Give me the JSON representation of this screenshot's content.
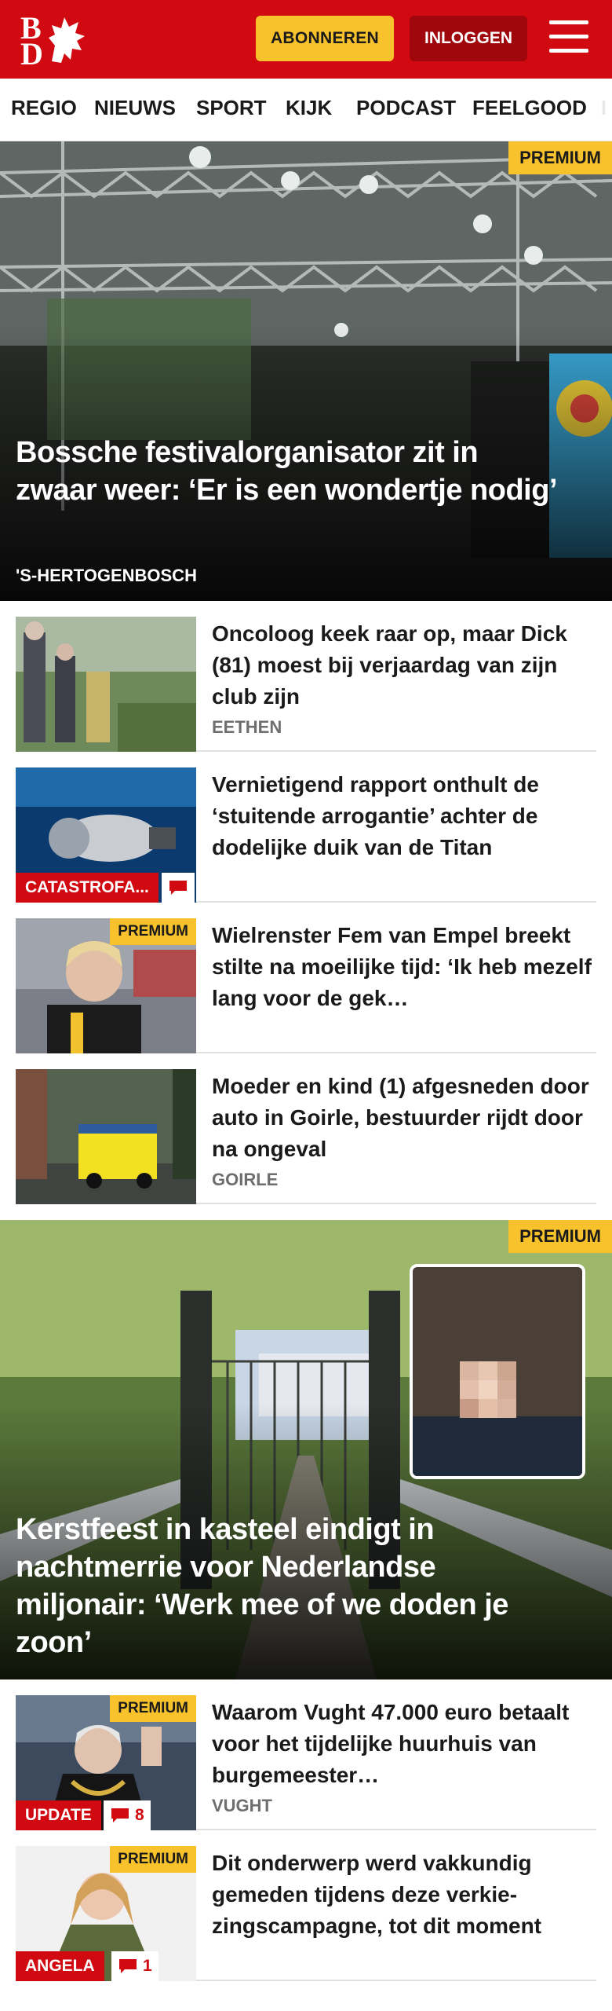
{
  "header": {
    "logo_b": "B",
    "logo_d": "D",
    "subscribe_label": "ABONNEREN",
    "login_label": "INLOGGEN"
  },
  "nav": {
    "items": [
      "REGIO",
      "NIEUWS",
      "SPORT",
      "KIJK",
      "PODCAST",
      "FEELGOOD",
      "I"
    ]
  },
  "hero1": {
    "premium": "PREMIUM",
    "title": "Bossche festivalorganisator zit in zwaar weer: ‘Er is een wondertje nodig’",
    "location": "'S-HERTOGENBOSCH"
  },
  "articles": [
    {
      "title": "Oncoloog keek raar op, maar Dick (81) moest bij verjaardag van zijn club zijn",
      "location": "EETHEN"
    },
    {
      "title": "Vernietigend rapport onthult de ‘stuitende arrogantie’ achter de dodelijke duik van de Titan",
      "label": "CATASTROFA..."
    },
    {
      "premium": "PREMIUM",
      "title": "Wielrenster Fem van Empel breekt stilte na moeilijke tijd: ‘Ik heb mezelf lang voor de gek…"
    },
    {
      "title": "Moeder en kind (1) afgesneden door auto in Goirle, bestuurder rijdt door na ongeval",
      "location": "GOIRLE"
    }
  ],
  "hero2": {
    "premium": "PREMIUM",
    "title": "Kerstfeest in kasteel eindigt in nachtmerrie voor Nederlandse miljonair: ‘Werk mee of we doden je zoon’"
  },
  "articles2": [
    {
      "premium": "PREMIUM",
      "title": "Waarom Vught 47.000 euro betaalt voor het tijdelijke huurhuis van burgemeester…",
      "location": "VUGHT",
      "label": "UPDATE",
      "comments": "8"
    },
    {
      "premium": "PREMIUM",
      "title": "Dit onderwerp werd vakkundig gemeden tijdens deze verkie­zingscampagne, tot dit moment",
      "label": "ANGELA",
      "comments": "1"
    }
  ],
  "colors": {
    "brand_red": "#d10a11",
    "premium_yellow": "#f8c22c",
    "login_dark_red": "#a0070d"
  },
  "icons": {
    "logo": "griffin-logo-icon",
    "menu": "hamburger-menu-icon",
    "comment": "comment-bubble-icon"
  }
}
